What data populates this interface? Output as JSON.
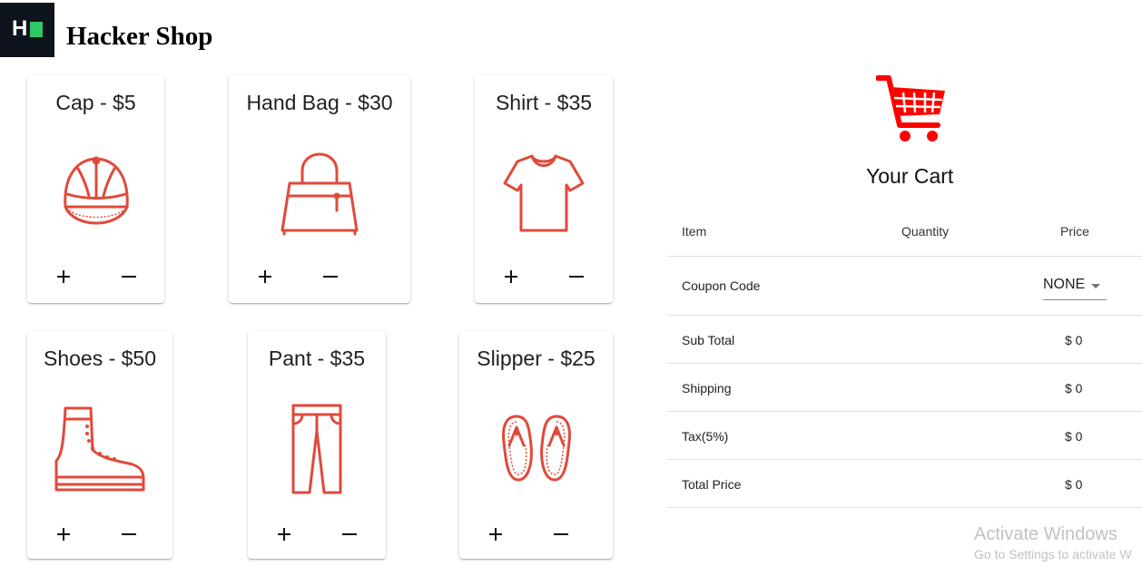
{
  "app": {
    "brand": "Hacker Shop",
    "logo_letter": "H"
  },
  "products": [
    {
      "title": "Cap - $5",
      "icon": "cap-icon"
    },
    {
      "title": "Hand Bag - $30",
      "icon": "handbag-icon"
    },
    {
      "title": "Shirt - $35",
      "icon": "shirt-icon"
    },
    {
      "title": "Shoes - $50",
      "icon": "boot-icon"
    },
    {
      "title": "Pant - $35",
      "icon": "pant-icon"
    },
    {
      "title": "Slipper - $25",
      "icon": "slipper-icon"
    }
  ],
  "cart": {
    "title": "Your Cart",
    "headers": {
      "item": "Item",
      "quantity": "Quantity",
      "price": "Price"
    },
    "coupon_label": "Coupon Code",
    "coupon_value": "NONE",
    "subtotal_label": "Sub Total",
    "subtotal_value": "$ 0",
    "shipping_label": "Shipping",
    "shipping_value": "$ 0",
    "tax_label": "Tax(5%)",
    "tax_value": "$ 0",
    "total_label": "Total Price",
    "total_value": "$ 0"
  },
  "watermark": {
    "line1": "Activate Windows",
    "line2": "Go to Settings to activate W"
  },
  "colors": {
    "accent": "#e04a3a",
    "cart_red": "#ff0000",
    "logo_bg": "#0e141e",
    "logo_green": "#2ec866"
  }
}
